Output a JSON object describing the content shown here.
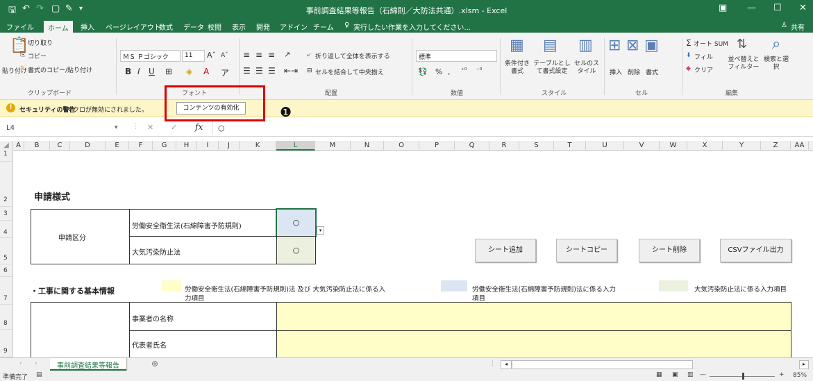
{
  "title": "事前調査結果等報告（石綿則／大防法共通）.xlsm - Excel",
  "menu": {
    "file": "ファイル",
    "tabs": [
      "ホーム",
      "挿入",
      "ページレイアウト",
      "数式",
      "データ",
      "校閲",
      "表示",
      "開発",
      "アドイン",
      "チーム"
    ],
    "search": "実行したい作業を入力してください...",
    "share": "共有"
  },
  "ribbon": {
    "paste": "貼り付け",
    "cut": "切り取り",
    "copy": "コピー",
    "format_painter": "書式のコピー/貼り付け",
    "font_name": "ＭＳ Ｐゴシック",
    "font_size": "11",
    "wrap_text": "折り返して全体を表示する",
    "merge_center": "セルを結合して中央揃え",
    "number_format": "標準",
    "conditional": "条件付き書式",
    "table": "テーブルとして書式設定",
    "cell_style": "セルのスタイル",
    "insert": "挿入",
    "delete": "削除",
    "format": "書式",
    "autosum": "オート SUM",
    "fill": "フィル",
    "clear": "クリア",
    "sort": "並べ替えとフィルター",
    "find": "検索と選択",
    "groups": {
      "clipboard": "クリップボード",
      "font": "フォント",
      "alignment": "配置",
      "number": "数値",
      "styles": "スタイル",
      "cells": "セル",
      "editing": "編集"
    }
  },
  "security": {
    "title": "セキュリティの警告",
    "message": "マクロが無効にされました。",
    "button": "コンテンツの有効化",
    "marker": "❶"
  },
  "formula": {
    "namebox": "L4",
    "content": "○"
  },
  "columns": [
    "A",
    "B",
    "C",
    "D",
    "E",
    "F",
    "G",
    "H",
    "I",
    "J",
    "K",
    "L",
    "M",
    "N",
    "O",
    "P",
    "Q",
    "R",
    "S",
    "T",
    "U",
    "V",
    "W",
    "X",
    "Y",
    "Z",
    "AA"
  ],
  "rows": [
    "1",
    "2",
    "3",
    "4",
    "5",
    "6",
    "7",
    "8",
    "9"
  ],
  "sheet": {
    "heading": "申請様式",
    "category_label": "申請区分",
    "law1": "労働安全衛生法(石綿障害予防規則)",
    "law2": "大気汚染防止法",
    "mark1": "○",
    "mark2": "○",
    "btn_add": "シート追加",
    "btn_copy": "シートコピー",
    "btn_delete": "シート削除",
    "btn_csv": "CSVファイル出力",
    "basic_info": "・工事に関する基本情報",
    "legend1a": "労働安全衛生法(石綿障害予防規則)法 及び 大気汚染防止法に係る入",
    "legend1b": "力項目",
    "legend2a": "労働安全衛生法(石綿障害予防規則)法に係る入力",
    "legend2b": "項目",
    "legend3": "大気汚染防止法に係る入力項目",
    "business_name": "事業者の名称",
    "representative": "代表者氏名"
  },
  "sheet_tab": "事前調査結果等報告",
  "status": {
    "ready": "準備完了",
    "zoom": "85%"
  },
  "colors": {
    "excel_green": "#217346",
    "yellow_input": "#fffdc8",
    "blue_input": "#dce6f2",
    "green_input": "#ebf1de",
    "highlight": "#e00000"
  }
}
